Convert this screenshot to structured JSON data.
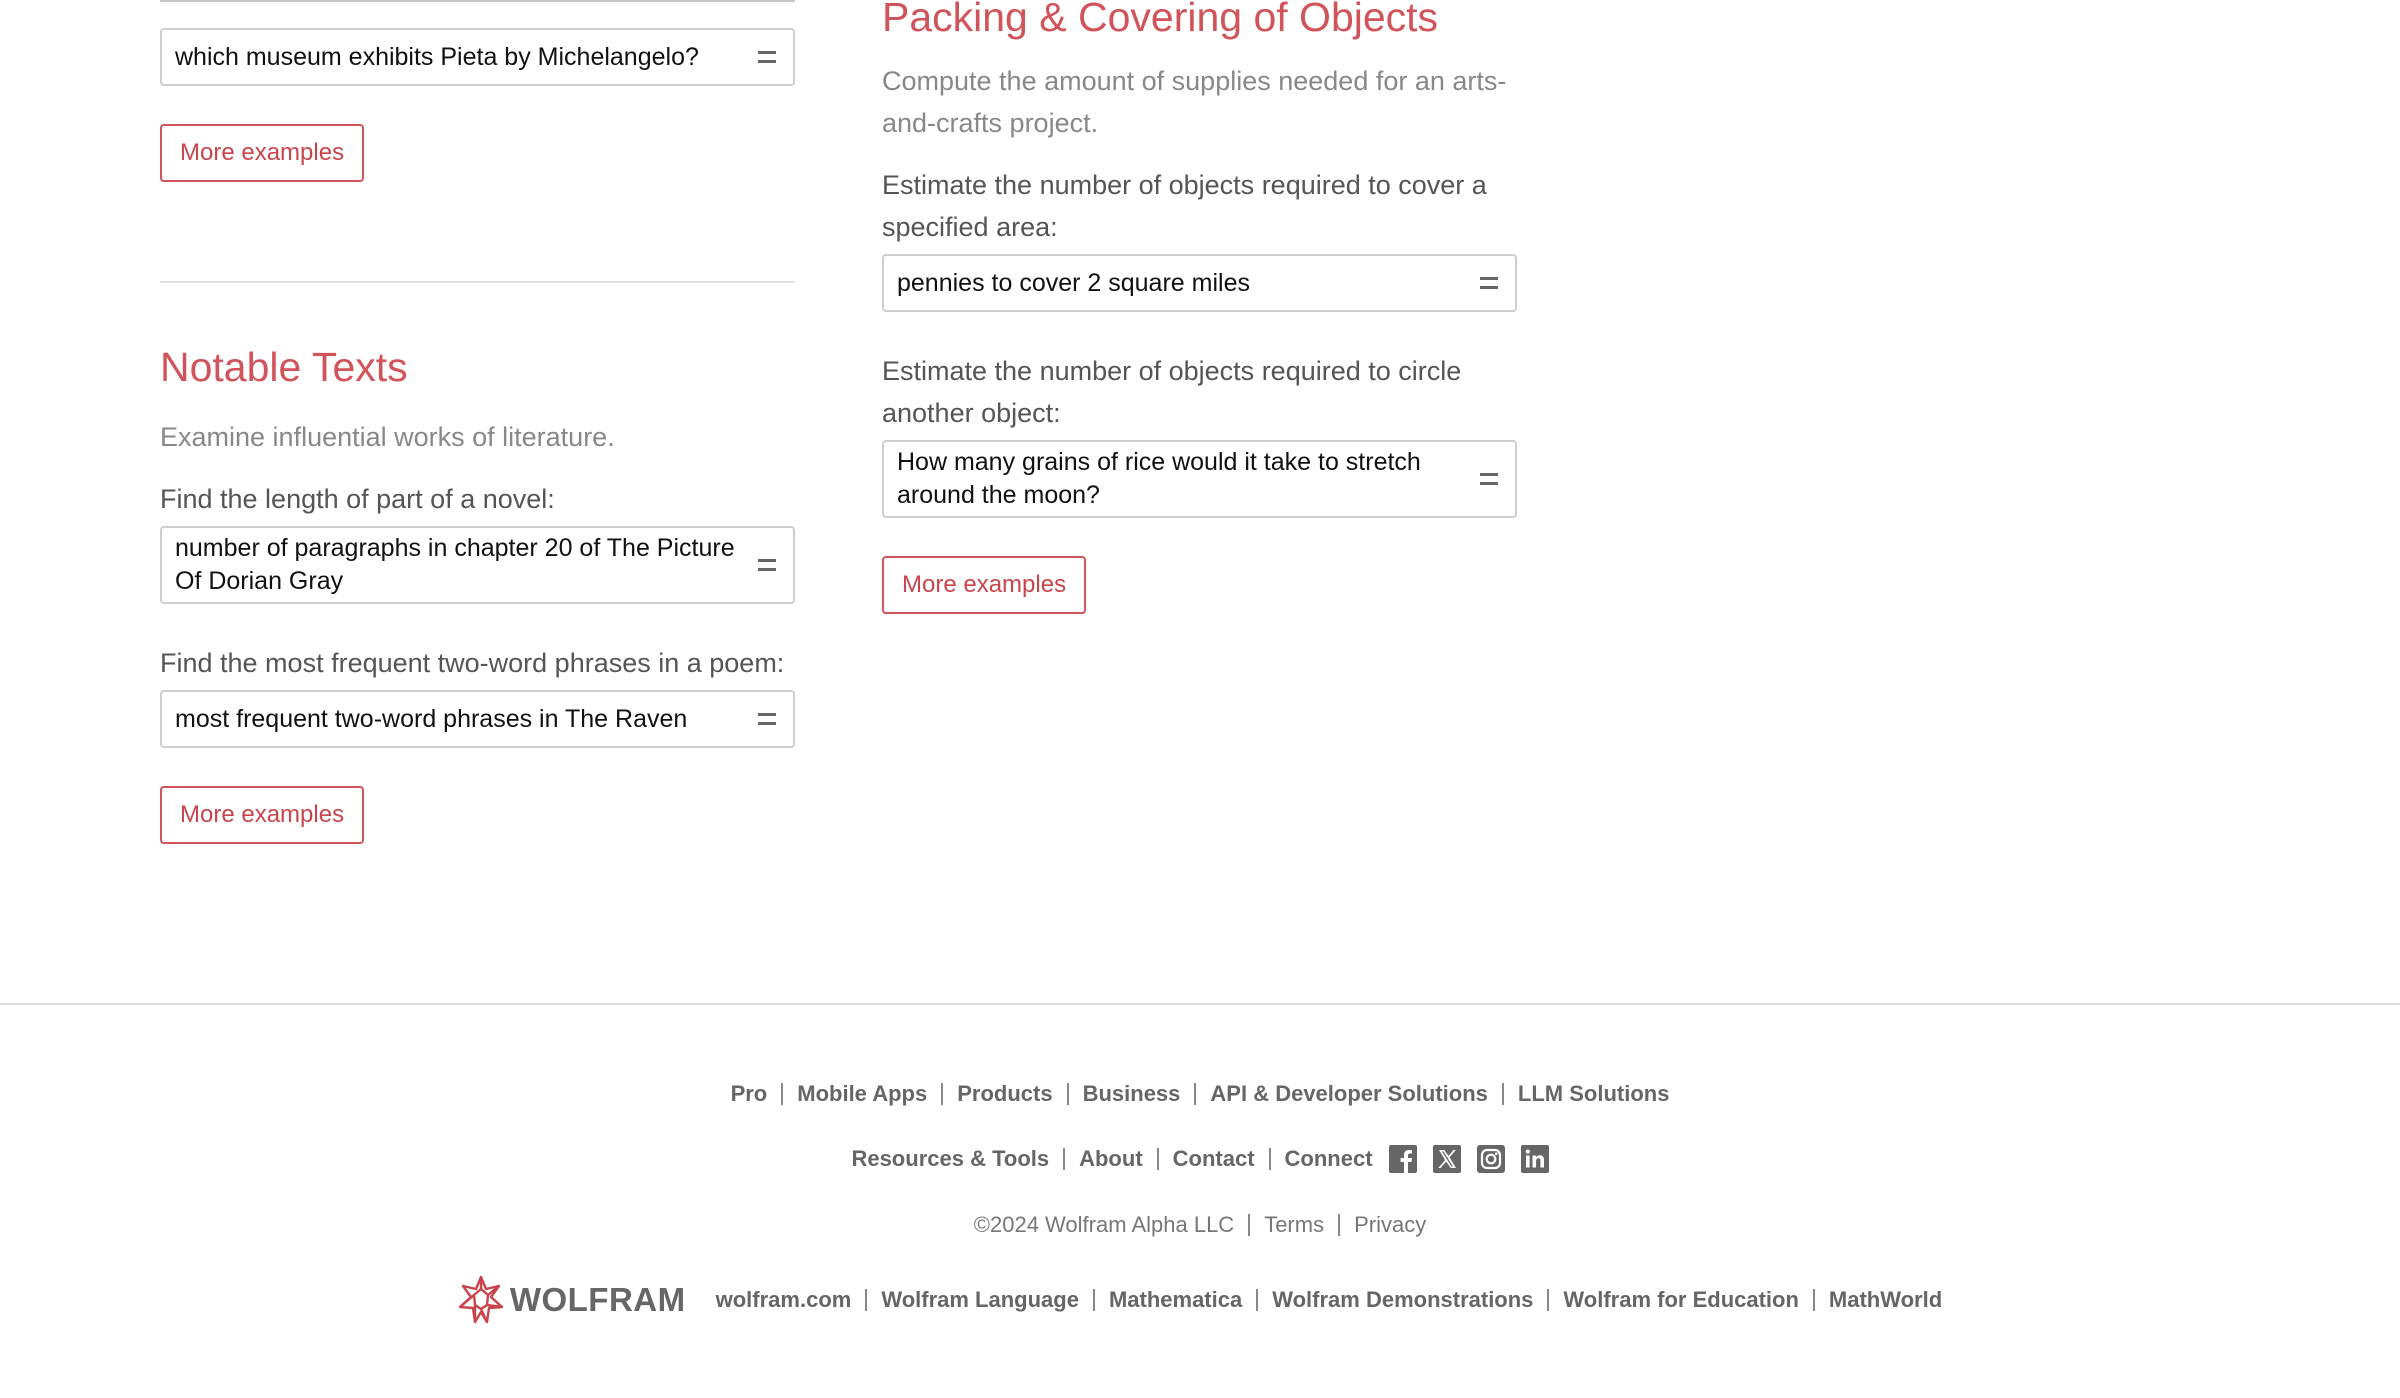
{
  "left_column": {
    "art_query": "which museum exhibits Pieta by Michelangelo?",
    "art_more": "More examples",
    "notable_texts": {
      "title": "Notable Texts",
      "description": "Examine influential works of literature.",
      "prompt1": "Find the length of part of a novel:",
      "query1": "number of paragraphs in chapter 20 of The Picture Of Dorian Gray",
      "prompt2": "Find the most frequent two-word phrases in a poem:",
      "query2": "most frequent two-word phrases in The Raven",
      "more": "More examples"
    }
  },
  "right_column": {
    "packing": {
      "title": "Packing & Covering of Objects",
      "description": "Compute the amount of supplies needed for an arts-and-crafts project.",
      "prompt1": "Estimate the number of objects required to cover a specified area:",
      "query1": "pennies to cover 2 square miles",
      "prompt2": "Estimate the number of objects required to circle another object:",
      "query2": "How many grains of rice would it take to stretch around the moon?",
      "more": "More examples"
    }
  },
  "footer": {
    "row1": [
      "Pro",
      "Mobile Apps",
      "Products",
      "Business",
      "API & Developer Solutions",
      "LLM Solutions"
    ],
    "row2": [
      "Resources & Tools",
      "About",
      "Contact",
      "Connect"
    ],
    "social_icons": [
      "facebook-icon",
      "x-icon",
      "instagram-icon",
      "linkedin-icon"
    ],
    "copyright": "©2024  Wolfram Alpha LLC",
    "terms": "Terms",
    "privacy": "Privacy",
    "logo_text": "WOLFRAM",
    "row4": [
      "wolfram.com",
      "Wolfram Language",
      "Mathematica",
      "Wolfram Demonstrations",
      "Wolfram for Education",
      "MathWorld"
    ]
  },
  "colors": {
    "accent": "#d0545a",
    "footer_link": "#666666"
  }
}
